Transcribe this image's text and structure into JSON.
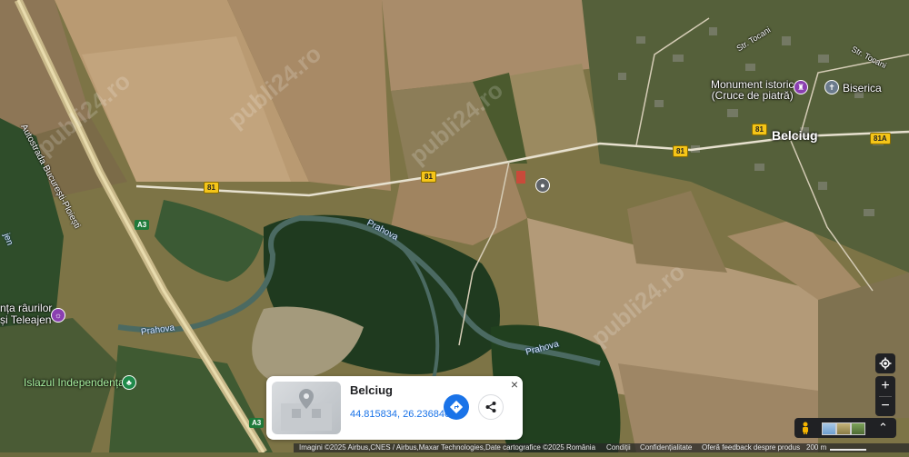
{
  "map": {
    "road_labels": {
      "highway": "Autostrada București-Ploiești",
      "str_tocani_1": "Str. Tocani",
      "str_tocani_2": "Str. Tocani"
    },
    "road_shields": {
      "b81_a": "81",
      "b81_b": "81",
      "b81_c": "81",
      "b81_d": "81",
      "b81a": "81A",
      "a3_a": "A3",
      "a3_b": "A3"
    },
    "rivers": {
      "prahova_1": "Prahova",
      "prahova_2": "Prahova",
      "prahova_3": "Prahova",
      "left_river": "jen"
    },
    "places": {
      "monument_line1": "Monument istoric",
      "monument_line2": "(Cruce de piatră)",
      "biserica": "Biserica",
      "belciug": "Belciug",
      "confluence_line1": "nța râurilor",
      "confluence_line2": "și Teleajen",
      "islazul": "Islazul Independența"
    },
    "watermark": "publi24.ro"
  },
  "card": {
    "title": "Belciug",
    "coords": "44.815834, 26.236846",
    "close_label": "×"
  },
  "controls": {
    "zoom_in": "+",
    "zoom_out": "−"
  },
  "footer": {
    "attribution": "Imagini ©2025 Airbus,CNES / Airbus,Maxar Technologies,Date cartografice ©2025",
    "country": "România",
    "terms": "Condiții",
    "privacy": "Confidențialitate",
    "feedback": "Oferă feedback despre produs",
    "scale": "200 m"
  }
}
